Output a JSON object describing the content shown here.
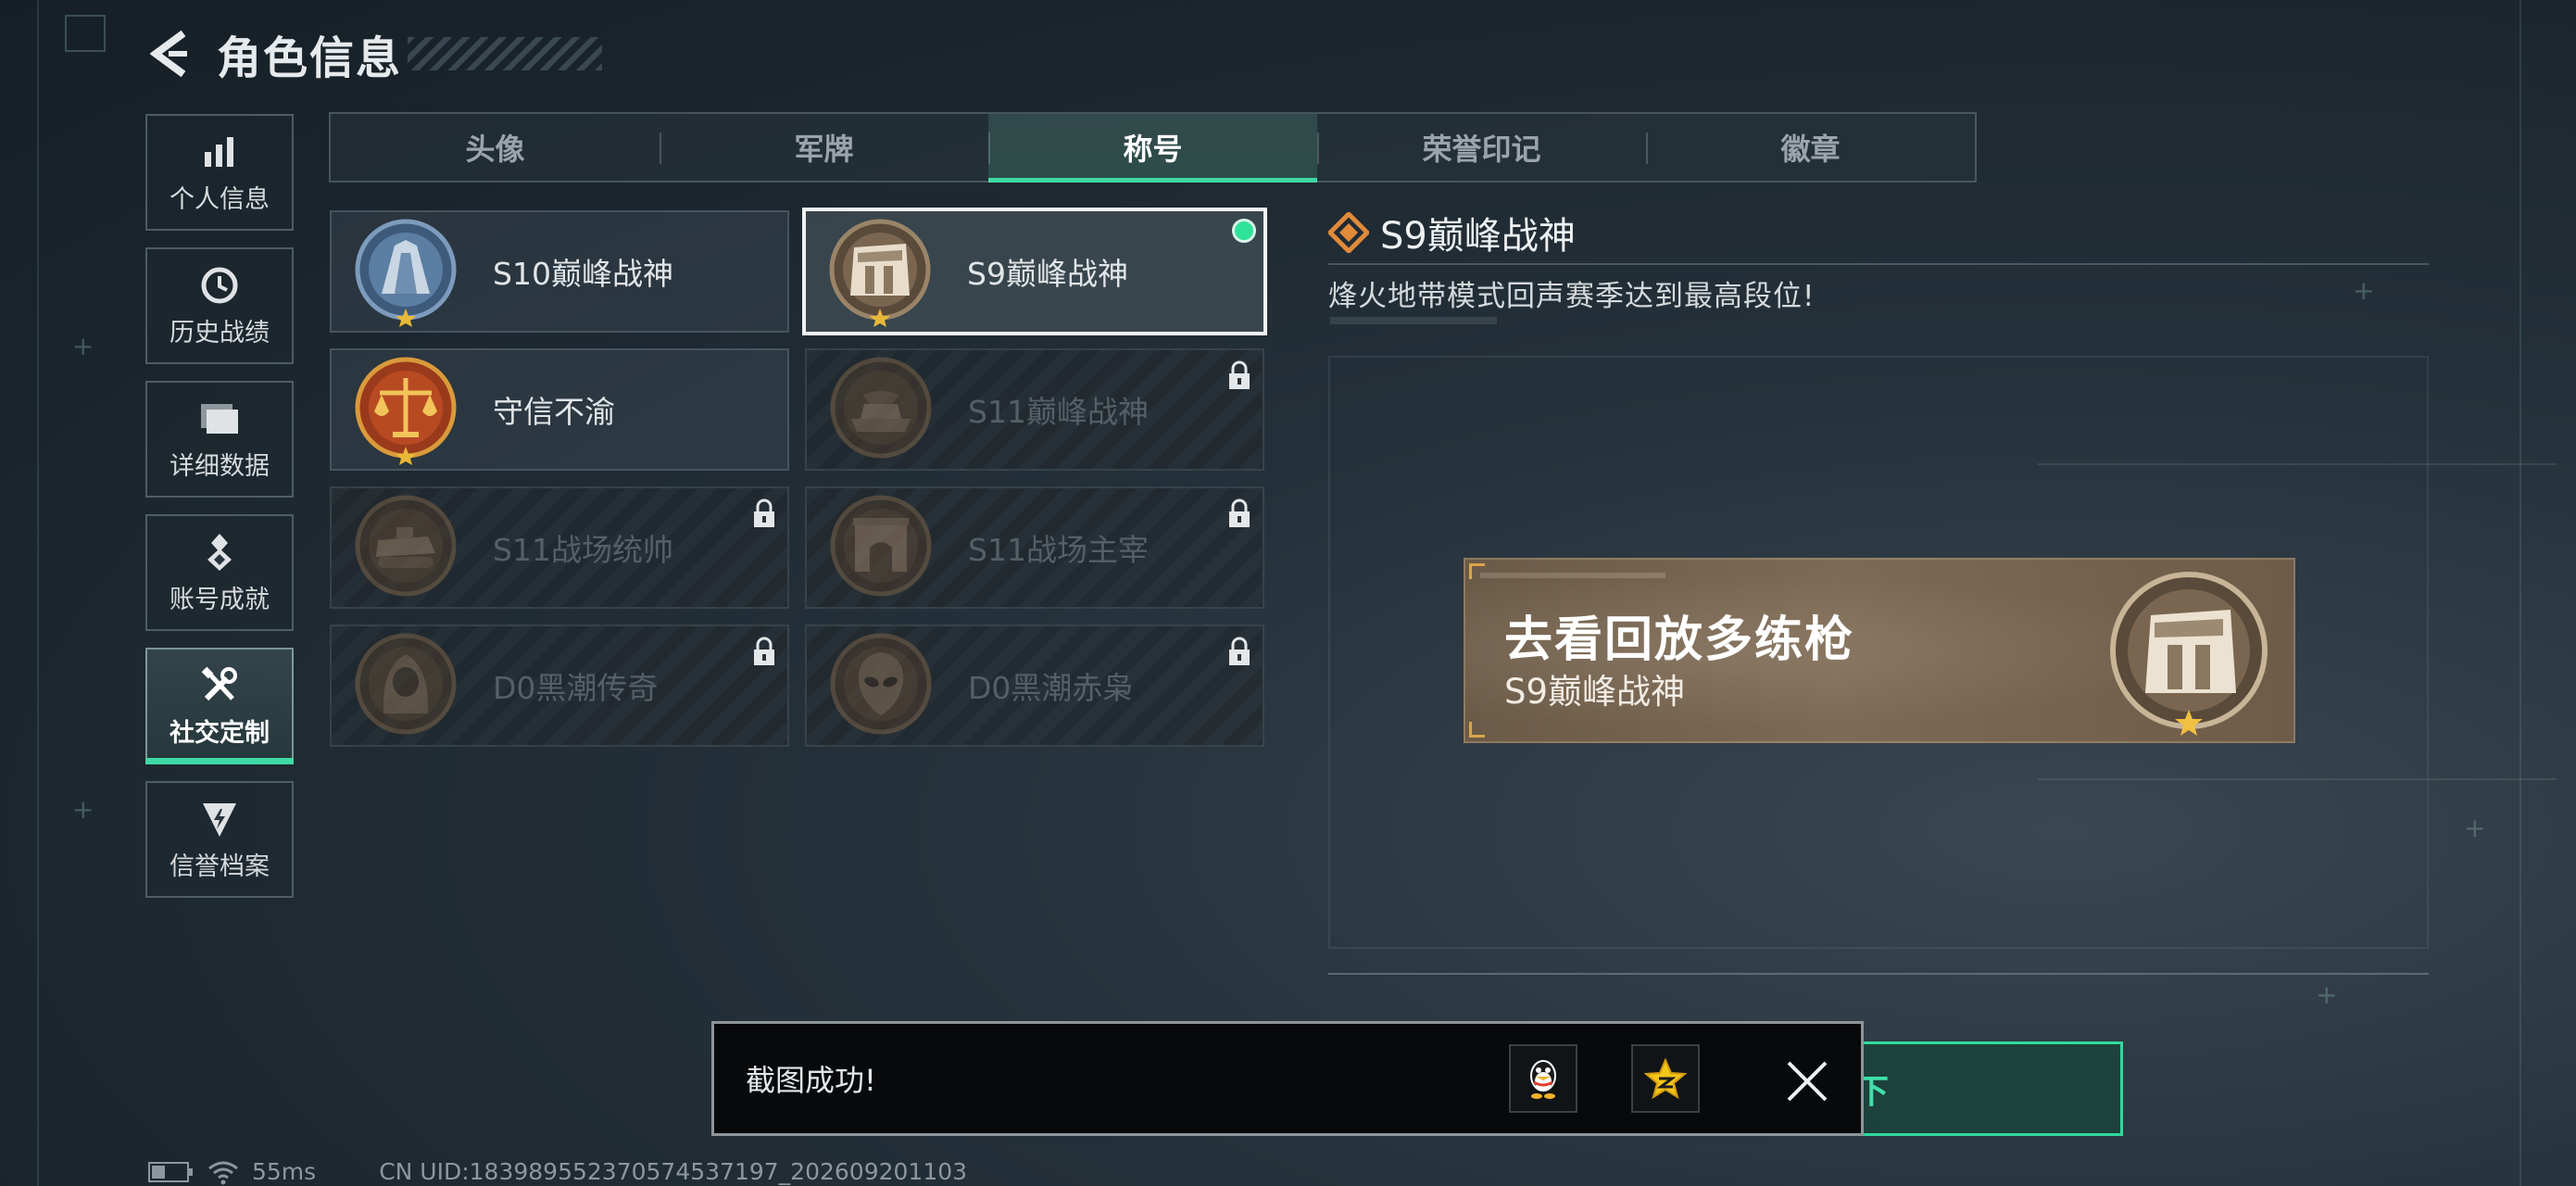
{
  "header": {
    "title": "角色信息"
  },
  "sidebar": {
    "items": [
      {
        "label": "个人信息",
        "icon": "bar-chart-icon",
        "active": false
      },
      {
        "label": "历史战绩",
        "icon": "clock-icon",
        "active": false
      },
      {
        "label": "详细数据",
        "icon": "folder-icon",
        "active": false
      },
      {
        "label": "账号成就",
        "icon": "medal-icon",
        "active": false
      },
      {
        "label": "社交定制",
        "icon": "tools-icon",
        "active": true
      },
      {
        "label": "信誉档案",
        "icon": "shield-icon",
        "active": false
      }
    ]
  },
  "tabs": [
    {
      "label": "头像",
      "active": false
    },
    {
      "label": "军牌",
      "active": false
    },
    {
      "label": "称号",
      "active": true
    },
    {
      "label": "荣誉印记",
      "active": false
    },
    {
      "label": "徽章",
      "active": false
    }
  ],
  "titles": [
    {
      "name": "S10巅峰战神",
      "locked": false,
      "selected": false,
      "equipped": false,
      "medal": "blue-tower-medal"
    },
    {
      "name": "S9巅峰战神",
      "locked": false,
      "selected": true,
      "equipped": true,
      "medal": "bronze-building-medal"
    },
    {
      "name": "守信不渝",
      "locked": false,
      "selected": false,
      "equipped": false,
      "medal": "scales-medal"
    },
    {
      "name": "S11巅峰战神",
      "locked": true,
      "selected": false,
      "equipped": false,
      "medal": "tank-medal"
    },
    {
      "name": "S11战场统帅",
      "locked": true,
      "selected": false,
      "equipped": false,
      "medal": "apc-medal"
    },
    {
      "name": "S11战场主宰",
      "locked": true,
      "selected": false,
      "equipped": false,
      "medal": "arch-medal"
    },
    {
      "name": "D0黑潮传奇",
      "locked": true,
      "selected": false,
      "equipped": false,
      "medal": "hooded-figure-medal"
    },
    {
      "name": "D0黑潮赤枭",
      "locked": true,
      "selected": false,
      "equipped": false,
      "medal": "alien-medal"
    }
  ],
  "detail": {
    "title": "S9巅峰战神",
    "description": "烽火地带模式回声赛季达到最高段位!",
    "banner_slogan": "去看回放多练枪",
    "banner_subtitle": "S9巅峰战神"
  },
  "unequip_button": {
    "label": "卸下"
  },
  "toast": {
    "message": "截图成功!"
  },
  "status": {
    "ping": "55ms",
    "uid": "CN UID:18398955237057453719​7_202609201103"
  },
  "colors": {
    "accent": "#3fd9a6",
    "equipped_dot": "#2fe29a"
  }
}
